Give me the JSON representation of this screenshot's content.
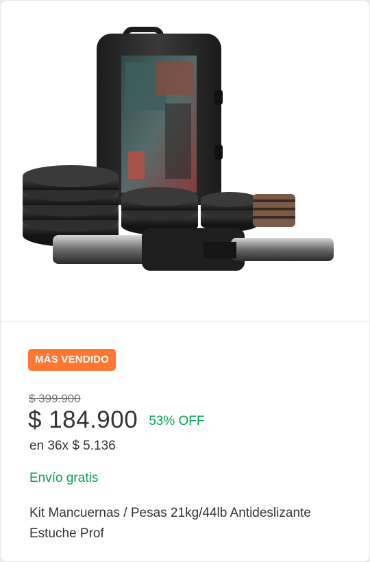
{
  "product": {
    "badge": "MÁS VENDIDO",
    "old_price": "$ 399.900",
    "price": "$ 184.900",
    "discount": "53% OFF",
    "installments": "en 36x $ 5.136",
    "shipping": "Envío gratis",
    "title": "Kit Mancuernas / Pesas 21kg/44lb Antideslizante Estuche Prof",
    "colors": {
      "badge_bg": "#ff7733",
      "discount": "#00a650",
      "shipping": "#00a650"
    }
  }
}
